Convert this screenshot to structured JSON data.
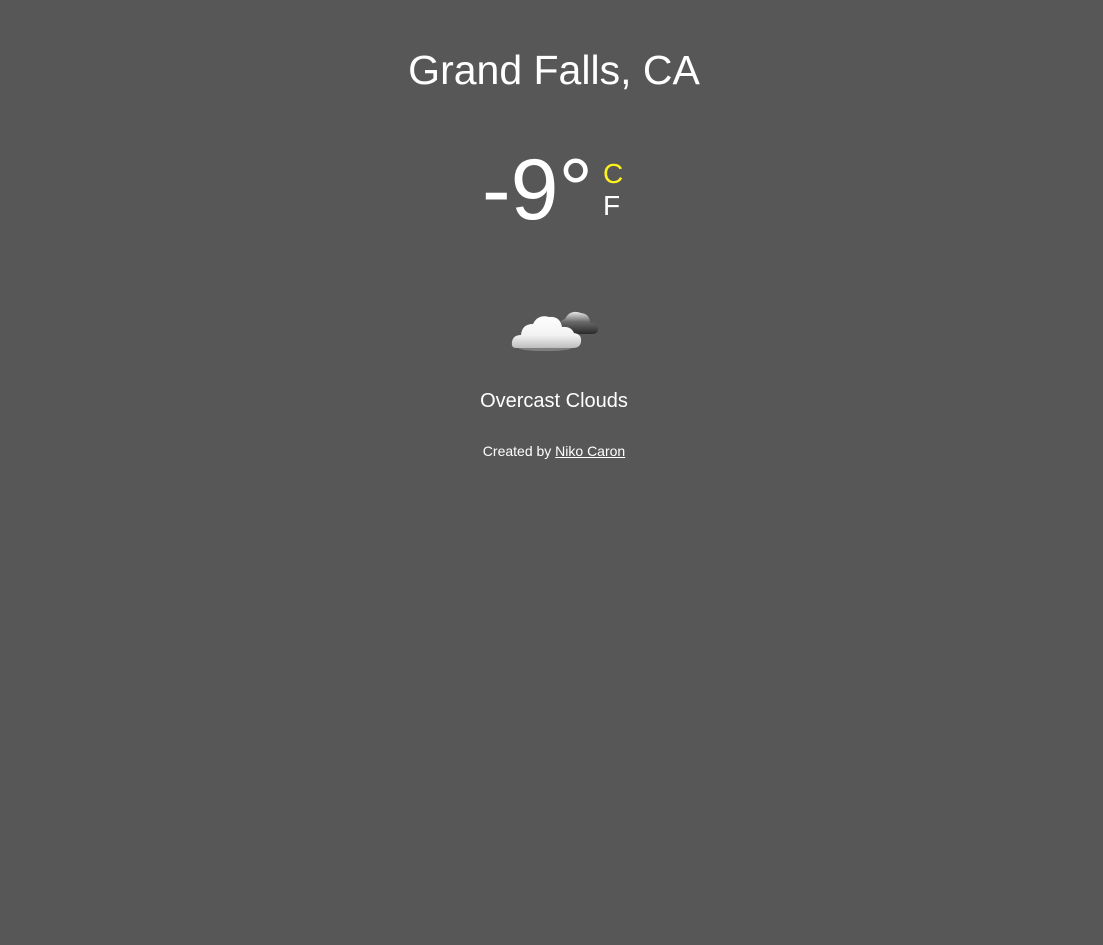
{
  "location": {
    "name": "Grand Falls, CA"
  },
  "temperature": {
    "value": "-9°",
    "unit_celsius": "C",
    "unit_fahrenheit": "F",
    "active_unit": "C"
  },
  "weather": {
    "icon": "cloud-icon",
    "description": "Overcast Clouds"
  },
  "footer": {
    "prefix": "Created by",
    "author": "Niko Caron"
  },
  "colors": {
    "background": "#575757",
    "text": "#ffffff",
    "active_unit": "#fdf21d"
  }
}
